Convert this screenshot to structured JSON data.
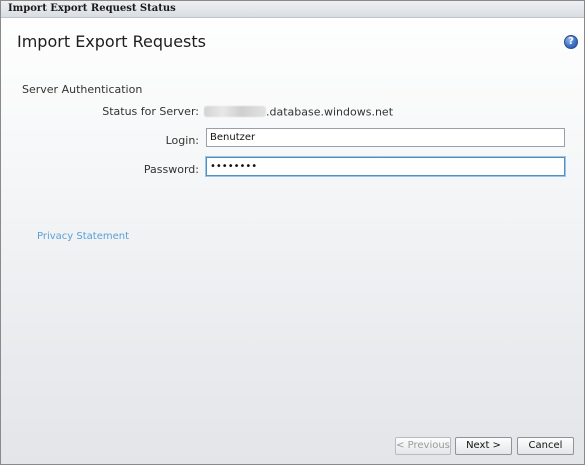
{
  "window": {
    "title": "Import Export Request Status"
  },
  "page": {
    "heading": "Import Export Requests",
    "help_icon": "question-help-icon"
  },
  "server_auth": {
    "section_title": "Server Authentication",
    "status_label": "Status for Server:",
    "server_suffix": ".database.windows.net",
    "login_label": "Login:",
    "login_value": "Benutzer",
    "password_label": "Password:",
    "password_value": "••••••••"
  },
  "links": {
    "privacy": "Privacy Statement"
  },
  "buttons": {
    "previous": "< Previous",
    "next": "Next >",
    "cancel": "Cancel"
  },
  "colors": {
    "link": "#5a9fd6",
    "focus_border": "#4f8fc4",
    "help_icon": "#3f73c8"
  }
}
